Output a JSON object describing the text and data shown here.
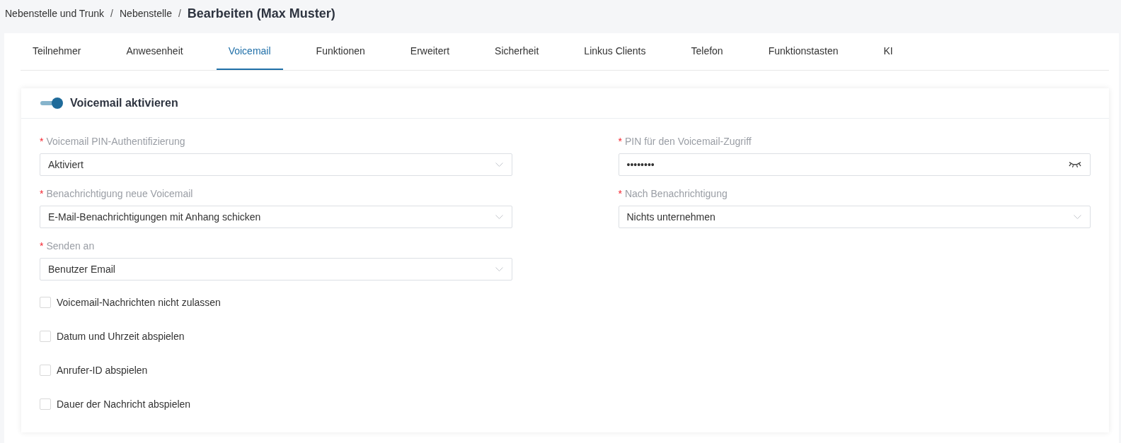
{
  "breadcrumb": [
    {
      "label": "Nebenstelle und Trunk",
      "separator": "/"
    },
    {
      "label": "Nebenstelle",
      "separator": "/"
    }
  ],
  "page_title": "Bearbeiten (Max Muster)",
  "tabs": [
    {
      "label": "Teilnehmer",
      "selected": false
    },
    {
      "label": "Anwesenheit",
      "selected": false
    },
    {
      "label": "Voicemail",
      "selected": true
    },
    {
      "label": "Funktionen",
      "selected": false
    },
    {
      "label": "Erweitert",
      "selected": false
    },
    {
      "label": "Sicherheit",
      "selected": false
    },
    {
      "label": "Linkus Clients",
      "selected": false
    },
    {
      "label": "Telefon",
      "selected": false
    },
    {
      "label": "Funktionstasten",
      "selected": false
    },
    {
      "label": "KI",
      "selected": false
    }
  ],
  "section": {
    "title": "Voicemail aktivieren",
    "on": true
  },
  "fields": [
    {
      "label": "Voicemail PIN-Authentifizierung",
      "required_mark": "*",
      "kind": "select",
      "value": "Aktiviert"
    },
    {
      "label": "PIN für den Voicemail-Zugriff",
      "required_mark": "*",
      "kind": "password",
      "value": "••••••••"
    },
    {
      "label": "Benachrichtigung neue Voicemail",
      "required_mark": "*",
      "kind": "select",
      "value": "E-Mail-Benachrichtigungen mit Anhang schicken"
    },
    {
      "label": "Nach Benachrichtigung",
      "required_mark": "*",
      "kind": "select",
      "value": "Nichts unternehmen"
    },
    {
      "label": "Senden an",
      "required_mark": "*",
      "kind": "select",
      "value": "Benutzer Email"
    }
  ],
  "checkboxes": [
    {
      "label": "Voicemail-Nachrichten nicht zulassen",
      "checked": false
    },
    {
      "label": "Datum und Uhrzeit abspielen",
      "checked": false
    },
    {
      "label": "Anrufer-ID abspielen",
      "checked": false
    },
    {
      "label": "Dauer der Nachricht abspielen",
      "checked": false
    }
  ]
}
